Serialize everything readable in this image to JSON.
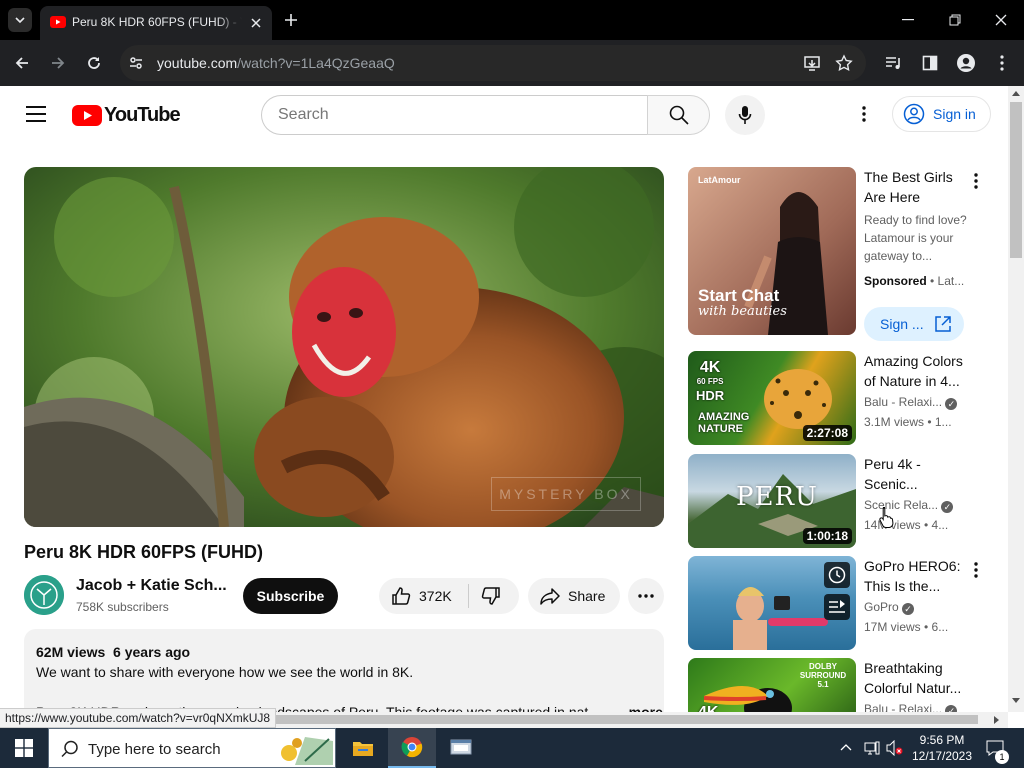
{
  "browser": {
    "tab_title": "Peru 8K HDR 60FPS (FUHD) - YouTube",
    "url_host": "youtube.com",
    "url_path": "/watch?v=1La4QzGeaaQ",
    "status_url": "https://www.youtube.com/watch?v=vr0qNXmkUJ8"
  },
  "masthead": {
    "logo_text": "YouTube",
    "search_placeholder": "Search",
    "signin_label": "Sign in"
  },
  "video": {
    "watermark": "MYSTERY BOX",
    "title": "Peru 8K HDR 60FPS (FUHD)",
    "channel_name": "Jacob + Katie Sch...",
    "subscribers": "758K subscribers",
    "subscribe_label": "Subscribe",
    "like_count": "372K",
    "share_label": "Share",
    "views": "62M views",
    "age": "6 years ago",
    "description_line1": "We want to share with everyone how we see the world in 8K.",
    "description_line2": "Peru 8K HDR and see the amazing landscapes of Peru. This footage was captured in nat",
    "more_label": "...more"
  },
  "sidebar": {
    "ad": {
      "brand": "LatAmour",
      "headline": "Start Chat",
      "tagline": "with beauties",
      "title_l1": "The Best Girls",
      "title_l2": "Are Here",
      "desc_l1": "Ready to find love?",
      "desc_l2": "Latamour is your",
      "desc_l3": "gateway to...",
      "sponsored": "Sponsored",
      "advertiser": "Lat...",
      "cta": "Sign ..."
    },
    "videos": [
      {
        "title_l1": "Amazing Colors",
        "title_l2": "of Nature in 4...",
        "channel": "Balu - Relaxi...",
        "meta": "3.1M views  •  1...",
        "duration": "2:27:08",
        "badge_4k": "4K",
        "badge_fps": "60 FPS",
        "badge_hdr": "HDR",
        "overlay_l1": "AMAZING",
        "overlay_l2": "NATURE"
      },
      {
        "title_l1": "Peru 4k -",
        "title_l2": "Scenic...",
        "channel": "Scenic Rela...",
        "meta": "14M views  •  4...",
        "duration": "1:00:18",
        "overlay": "PERU"
      },
      {
        "title_l1": "GoPro HERO6:",
        "title_l2": "This Is the...",
        "channel": "GoPro",
        "meta": "17M views  •  6...",
        "duration": ""
      },
      {
        "title_l1": "Breathtaking",
        "title_l2": "Colorful Natur...",
        "channel": "Balu - Relaxi...",
        "meta": "",
        "badge_4k": "4K",
        "overlay_audio": "DOLBY SURROUND 5.1"
      }
    ]
  },
  "taskbar": {
    "search_placeholder": "Type here to search",
    "time": "9:56 PM",
    "date": "12/17/2023",
    "notifications": "1"
  },
  "colors": {
    "youtube_red": "#ff0000",
    "link_blue": "#065fd4",
    "chrome_dark": "#202124"
  }
}
